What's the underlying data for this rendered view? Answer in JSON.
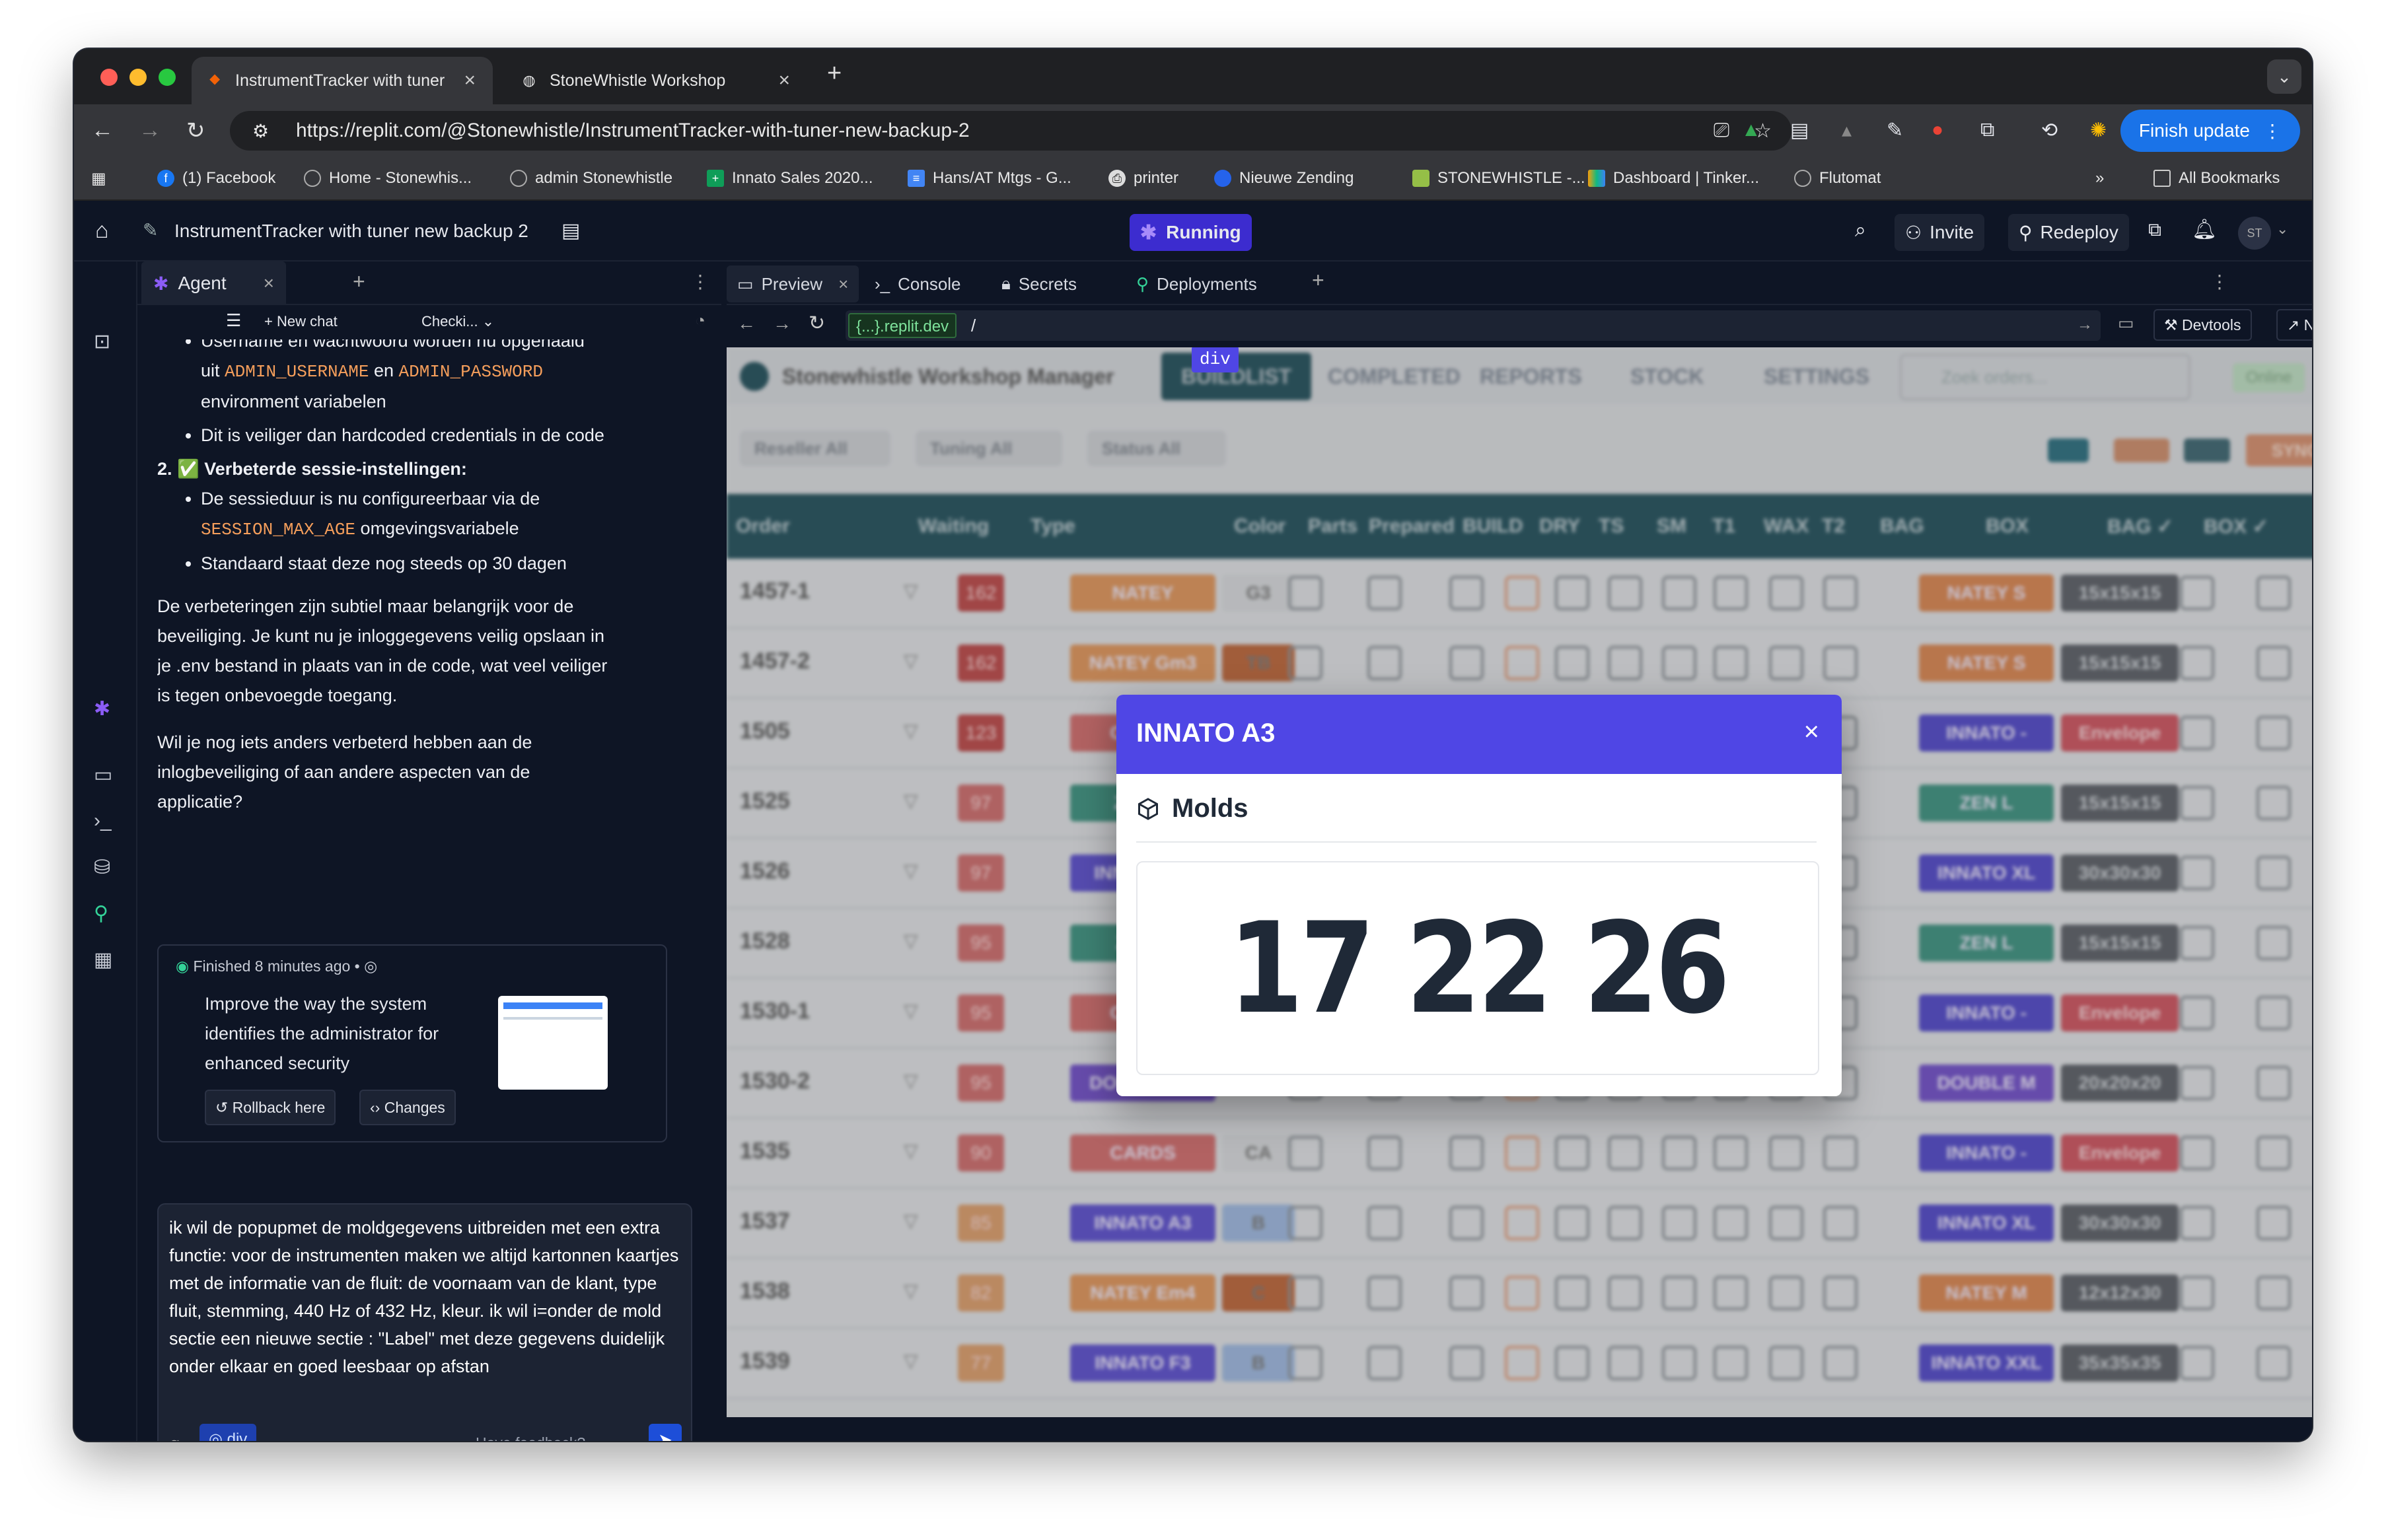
{
  "browser": {
    "tabs": [
      {
        "label": "InstrumentTracker with tuner"
      },
      {
        "label": "StoneWhistle Workshop"
      }
    ],
    "url": "https://replit.com/@Stonewhistle/InstrumentTracker-with-tuner-new-backup-2",
    "finish_update": "Finish update",
    "bookmarks": [
      "(1) Facebook",
      "Home - Stonewhis...",
      "admin Stonewhistle",
      "Innato Sales 2020...",
      "Hans/AT Mtgs - G...",
      "printer",
      "Nieuwe Zending",
      "STONEWHISTLE -...",
      "Dashboard | Tinker...",
      "Flutomat"
    ],
    "all_bookmarks": "All Bookmarks"
  },
  "replit": {
    "project_title": "InstrumentTracker with tuner new backup 2",
    "status": "Running",
    "invite": "Invite",
    "redeploy": "Redeploy",
    "avatar": "ST"
  },
  "agent": {
    "tab_label": "Agent",
    "new_chat": "New chat",
    "checkpoint": "Checki...",
    "msg": {
      "line0": "Username en wachtwoord worden nu opgehaald",
      "line1_pre": "uit ",
      "code_user": "ADMIN_USERNAME",
      "line1_mid": " en ",
      "code_pass": "ADMIN_PASSWORD",
      "line2": "environment variabelen",
      "bullet2": "Dit is veiliger dan hardcoded credentials in de code",
      "item2_num": "2.",
      "item2_check": "✅",
      "item2_title": "Verbeterde sessie-instellingen:",
      "b3_pre": "De sessieduur is nu configureerbaar via de",
      "code_session": "SESSION_MAX_AGE",
      "b3_post": " omgevingsvariabele",
      "b4": "Standaard staat deze nog steeds op 30 dagen",
      "para1": "De verbeteringen zijn subtiel maar belangrijk voor de beveiliging. Je kunt nu je inloggegevens veilig opslaan in je .env bestand in plaats van in de code, wat veel veiliger is tegen onbevoegde toegang.",
      "para2": "Wil je nog iets anders verbeterd hebben aan de inlogbeveiliging of aan andere aspecten van de applicatie?"
    },
    "card": {
      "status": "Finished",
      "time": "8 minutes ago",
      "bullet": "•",
      "text": "Improve the way the system identifies the administrator for enhanced security",
      "rollback": "Rollback here",
      "changes": "Changes"
    },
    "input_text": "ik wil de popupmet de moldgegevens uitbreiden met een extra functie: voor de instrumenten maken we altijd kartonnen kaartjes met de informatie van de fluit: de voornaam van de klant, type fluit, stemming, 440 Hz of 432 Hz,  kleur. ik wil i=onder de mold sectie een nieuwe sectie : \"Label\" met deze gegevens duidelijk onder elkaar en goed leesbaar op afstan",
    "element_chip": "div",
    "feedback": "Have feedback?"
  },
  "preview": {
    "tabs": [
      "Preview",
      "Console",
      "Secrets",
      "Deployments"
    ],
    "url_host": "{...}.replit.dev",
    "url_path": "/",
    "devtools": "Devtools",
    "newtab": "New tab"
  },
  "app": {
    "logo_text": "Stonewhistle Workshop Manager",
    "tabs": [
      "BUILDLIST",
      "COMPLETED",
      "REPORTS",
      "STOCK",
      "SETTINGS"
    ],
    "search_placeholder": "Zoek orders...",
    "online": "Online",
    "filters": [
      "Reseller  All",
      "Tuning  All",
      "Status  All"
    ],
    "sync": "SYNC",
    "columns": [
      "Order",
      "Waiting",
      "Type",
      "Color",
      "Parts",
      "Prepared",
      "BUILD",
      "DRY",
      "TS",
      "SM",
      "T1",
      "WAX",
      "T2",
      "BAG",
      "BOX",
      "BAG ✓",
      "BOX ✓"
    ],
    "rows": [
      {
        "order": "1457-1",
        "wait": "162",
        "type": "NATEY",
        "color": "G3",
        "bag": "NATEY S",
        "box": "15x15x15"
      },
      {
        "order": "1457-2",
        "wait": "162",
        "type": "NATEY  Gm3",
        "color": "TB",
        "bag": "NATEY S",
        "box": "15x15x15"
      },
      {
        "order": "1505",
        "wait": "123",
        "type": "CARDS",
        "color": "",
        "bag": "INNATO -",
        "box": "Envelope"
      },
      {
        "order": "1525",
        "wait": "97",
        "type": "ZEN  M",
        "color": "",
        "bag": "ZEN L",
        "box": "15x15x15"
      },
      {
        "order": "1526",
        "wait": "97",
        "type": "INNATO  A3",
        "color": "",
        "bag": "INNATO XL",
        "box": "30x30x30"
      },
      {
        "order": "1528",
        "wait": "95",
        "type": "ZEN  L",
        "color": "",
        "bag": "ZEN L",
        "box": "15x15x15"
      },
      {
        "order": "1530-1",
        "wait": "95",
        "type": "CARDS",
        "color": "",
        "bag": "INNATO -",
        "box": "Envelope"
      },
      {
        "order": "1530-2",
        "wait": "95",
        "type": "DOUBLE  B3",
        "color": "",
        "bag": "DOUBLE M",
        "box": "20x20x20"
      },
      {
        "order": "1535",
        "wait": "90",
        "type": "CARDS",
        "color": "CA",
        "bag": "INNATO -",
        "box": "Envelope"
      },
      {
        "order": "1537",
        "wait": "85",
        "type": "INNATO  A3",
        "color": "B",
        "bag": "INNATO XL",
        "box": "30x30x30"
      },
      {
        "order": "1538",
        "wait": "82",
        "type": "NATEY  Em4",
        "color": "C",
        "bag": "NATEY M",
        "box": "12x12x30"
      },
      {
        "order": "1539",
        "wait": "77",
        "type": "INNATO  F3",
        "color": "B",
        "bag": "INNATO XXL",
        "box": "35x35x35"
      }
    ]
  },
  "modal": {
    "inspector_tag": "div",
    "title": "INNATO A3",
    "close": "×",
    "section": "Molds",
    "value": "17 22 26"
  }
}
